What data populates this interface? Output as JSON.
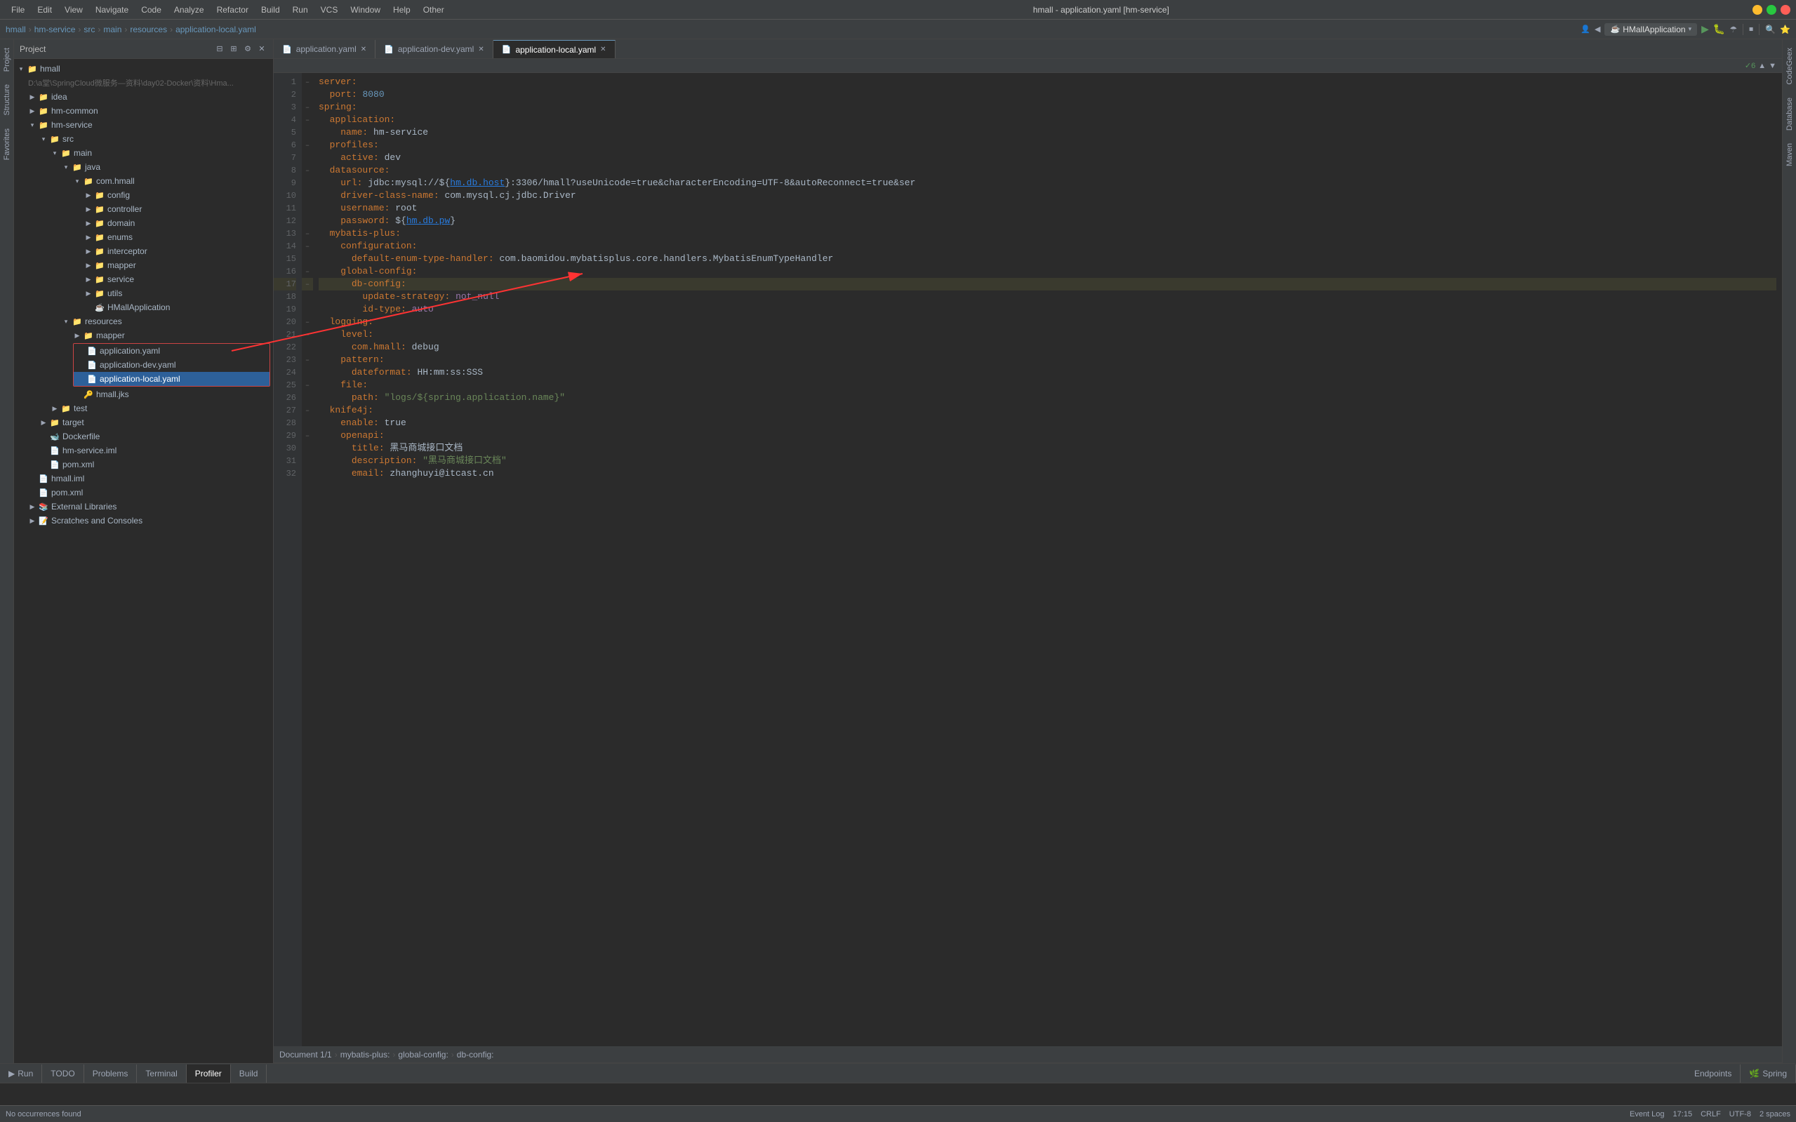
{
  "window": {
    "title": "hmall - application.yaml [hm-service]"
  },
  "menu": {
    "items": [
      "File",
      "Edit",
      "View",
      "Navigate",
      "Code",
      "Analyze",
      "Refactor",
      "Build",
      "Run",
      "VCS",
      "Window",
      "Help",
      "Other"
    ]
  },
  "project": {
    "label": "Project",
    "breadcrumb": [
      "hmall",
      "hm-service",
      "src",
      "main",
      "resources",
      "application-local.yaml"
    ]
  },
  "sidebar": {
    "title": "Project",
    "tree": [
      {
        "label": "hmall",
        "level": 0,
        "type": "project",
        "arrow": "▾",
        "icon": "📁"
      },
      {
        "label": "D:\\a堂\\SpringCloud微服务—资料\\day02-Docker\\资料\\Hma...",
        "level": 1,
        "type": "path",
        "arrow": "",
        "icon": ""
      },
      {
        "label": "idea",
        "level": 1,
        "type": "folder",
        "arrow": "▶",
        "icon": "📁"
      },
      {
        "label": "hm-common",
        "level": 1,
        "type": "folder",
        "arrow": "▶",
        "icon": "📁"
      },
      {
        "label": "hm-service",
        "level": 1,
        "type": "folder",
        "arrow": "▾",
        "icon": "📁"
      },
      {
        "label": "src",
        "level": 2,
        "type": "folder",
        "arrow": "▾",
        "icon": "📁"
      },
      {
        "label": "main",
        "level": 3,
        "type": "folder",
        "arrow": "▾",
        "icon": "📁"
      },
      {
        "label": "java",
        "level": 4,
        "type": "folder",
        "arrow": "▾",
        "icon": "📁"
      },
      {
        "label": "com.hmall",
        "level": 5,
        "type": "folder",
        "arrow": "▾",
        "icon": "📁"
      },
      {
        "label": "config",
        "level": 6,
        "type": "folder",
        "arrow": "▶",
        "icon": "📁"
      },
      {
        "label": "controller",
        "level": 6,
        "type": "folder",
        "arrow": "▶",
        "icon": "📁"
      },
      {
        "label": "domain",
        "level": 6,
        "type": "folder",
        "arrow": "▶",
        "icon": "📁"
      },
      {
        "label": "enums",
        "level": 6,
        "type": "folder",
        "arrow": "▶",
        "icon": "📁"
      },
      {
        "label": "interceptor",
        "level": 6,
        "type": "folder",
        "arrow": "▶",
        "icon": "📁"
      },
      {
        "label": "mapper",
        "level": 6,
        "type": "folder",
        "arrow": "▶",
        "icon": "📁"
      },
      {
        "label": "service",
        "level": 6,
        "type": "folder",
        "arrow": "▶",
        "icon": "📁"
      },
      {
        "label": "utils",
        "level": 6,
        "type": "folder",
        "arrow": "▶",
        "icon": "📁"
      },
      {
        "label": "HMallApplication",
        "level": 6,
        "type": "java",
        "arrow": "",
        "icon": "☕"
      },
      {
        "label": "resources",
        "level": 4,
        "type": "folder",
        "arrow": "▾",
        "icon": "📁"
      },
      {
        "label": "mapper",
        "level": 5,
        "type": "folder",
        "arrow": "▶",
        "icon": "📁"
      },
      {
        "label": "application.yaml",
        "level": 5,
        "type": "yaml",
        "arrow": "",
        "icon": "📄",
        "boxed": true
      },
      {
        "label": "application-dev.yaml",
        "level": 5,
        "type": "yaml",
        "arrow": "",
        "icon": "📄",
        "boxed": true
      },
      {
        "label": "application-local.yaml",
        "level": 5,
        "type": "yaml",
        "arrow": "",
        "icon": "📄",
        "selected": true,
        "boxed": true
      },
      {
        "label": "hmall.jks",
        "level": 5,
        "type": "file",
        "arrow": "",
        "icon": "🔑"
      },
      {
        "label": "test",
        "level": 3,
        "type": "folder",
        "arrow": "▶",
        "icon": "📁"
      },
      {
        "label": "target",
        "level": 2,
        "type": "folder",
        "arrow": "▶",
        "icon": "📁"
      },
      {
        "label": "Dockerfile",
        "level": 2,
        "type": "file",
        "arrow": "",
        "icon": "🐋"
      },
      {
        "label": "hm-service.iml",
        "level": 2,
        "type": "file",
        "arrow": "",
        "icon": "📄"
      },
      {
        "label": "pom.xml",
        "level": 2,
        "type": "file",
        "arrow": "",
        "icon": "📄"
      },
      {
        "label": "hmall.iml",
        "level": 1,
        "type": "file",
        "arrow": "",
        "icon": "📄"
      },
      {
        "label": "pom.xml",
        "level": 1,
        "type": "file",
        "arrow": "",
        "icon": "📄"
      },
      {
        "label": "External Libraries",
        "level": 1,
        "type": "folder",
        "arrow": "▶",
        "icon": "📚"
      },
      {
        "label": "Scratches and Consoles",
        "level": 1,
        "type": "folder",
        "arrow": "▶",
        "icon": "📝"
      }
    ]
  },
  "tabs": [
    {
      "label": "application.yaml",
      "active": false,
      "icon": "📄"
    },
    {
      "label": "application-dev.yaml",
      "active": false,
      "icon": "📄"
    },
    {
      "label": "application-local.yaml",
      "active": true,
      "icon": "📄"
    }
  ],
  "editor": {
    "lines": [
      {
        "num": 1,
        "code": "server:",
        "indent": 0,
        "fold": true
      },
      {
        "num": 2,
        "code": "  port: 8080",
        "indent": 1,
        "fold": false
      },
      {
        "num": 3,
        "code": "spring:",
        "indent": 0,
        "fold": true
      },
      {
        "num": 4,
        "code": "  application:",
        "indent": 1,
        "fold": true
      },
      {
        "num": 5,
        "code": "    name: hm-service",
        "indent": 2,
        "fold": false
      },
      {
        "num": 6,
        "code": "  profiles:",
        "indent": 1,
        "fold": true
      },
      {
        "num": 7,
        "code": "    active: dev",
        "indent": 2,
        "fold": false
      },
      {
        "num": 8,
        "code": "  datasource:",
        "indent": 1,
        "fold": true
      },
      {
        "num": 9,
        "code": "    url: jdbc:mysql://${hm.db.host}:3306/hmall?useUnicode=true&characterEncoding=UTF-8&autoReconnect=true&ser",
        "indent": 2,
        "fold": false
      },
      {
        "num": 10,
        "code": "    driver-class-name: com.mysql.cj.jdbc.Driver",
        "indent": 2,
        "fold": false
      },
      {
        "num": 11,
        "code": "    username: root",
        "indent": 2,
        "fold": false
      },
      {
        "num": 12,
        "code": "    password: ${hm.db.pw}",
        "indent": 2,
        "fold": false
      },
      {
        "num": 13,
        "code": "  mybatis-plus:",
        "indent": 1,
        "fold": true
      },
      {
        "num": 14,
        "code": "    configuration:",
        "indent": 2,
        "fold": true
      },
      {
        "num": 15,
        "code": "      default-enum-type-handler: com.baomidou.mybatisplus.core.handlers.MybatisEnumTypeHandler",
        "indent": 3,
        "fold": false
      },
      {
        "num": 16,
        "code": "    global-config:",
        "indent": 2,
        "fold": true
      },
      {
        "num": 17,
        "code": "      db-config:",
        "indent": 3,
        "fold": true,
        "highlighted": true
      },
      {
        "num": 18,
        "code": "        update-strategy: not_null",
        "indent": 4,
        "fold": false
      },
      {
        "num": 19,
        "code": "        id-type: auto",
        "indent": 4,
        "fold": false
      },
      {
        "num": 20,
        "code": "  logging:",
        "indent": 1,
        "fold": true
      },
      {
        "num": 21,
        "code": "    level:",
        "indent": 2,
        "fold": true
      },
      {
        "num": 22,
        "code": "      com.hmall: debug",
        "indent": 3,
        "fold": false
      },
      {
        "num": 23,
        "code": "    pattern:",
        "indent": 2,
        "fold": true
      },
      {
        "num": 24,
        "code": "      dateformat: HH:mm:ss:SSS",
        "indent": 3,
        "fold": false
      },
      {
        "num": 25,
        "code": "    file:",
        "indent": 2,
        "fold": true
      },
      {
        "num": 26,
        "code": "      path: \"logs/${spring.application.name}\"",
        "indent": 3,
        "fold": false
      },
      {
        "num": 27,
        "code": "  knife4j:",
        "indent": 1,
        "fold": true
      },
      {
        "num": 28,
        "code": "    enable: true",
        "indent": 2,
        "fold": false
      },
      {
        "num": 29,
        "code": "    openapi:",
        "indent": 2,
        "fold": true
      },
      {
        "num": 30,
        "code": "      title: 黑马商城接口文档",
        "indent": 3,
        "fold": false
      },
      {
        "num": 31,
        "code": "      description: \"黑马商城接口文档\"",
        "indent": 3,
        "fold": false
      },
      {
        "num": 32,
        "code": "      email: zhanghuyi@itcast.cn",
        "indent": 3,
        "fold": false
      }
    ]
  },
  "path_bar": {
    "segments": [
      "Document 1/1",
      "mybatis-plus:",
      "global-config:",
      "db-config:"
    ]
  },
  "bottom_tabs": [
    {
      "label": "Run",
      "icon": "▶"
    },
    {
      "label": "TODO",
      "icon": ""
    },
    {
      "label": "Problems",
      "icon": ""
    },
    {
      "label": "Terminal",
      "icon": ""
    },
    {
      "label": "Profiler",
      "icon": ""
    },
    {
      "label": "Build",
      "icon": ""
    }
  ],
  "bottom_extra_tabs": [
    {
      "label": "Endpoints",
      "icon": ""
    },
    {
      "label": "Spring",
      "icon": "🌿"
    }
  ],
  "status": {
    "left": "No occurrences found",
    "time": "17:15",
    "encoding_crlf": "CRLF",
    "encoding": "UTF-8",
    "indent": "2 spaces",
    "event_log": "Event Log"
  },
  "run_config": {
    "name": "HMallApplication"
  },
  "right_tabs": [
    "CodeGeex",
    "Database",
    "Maven"
  ],
  "left_tabs": [
    "Project",
    "Structure",
    "Favorites"
  ]
}
